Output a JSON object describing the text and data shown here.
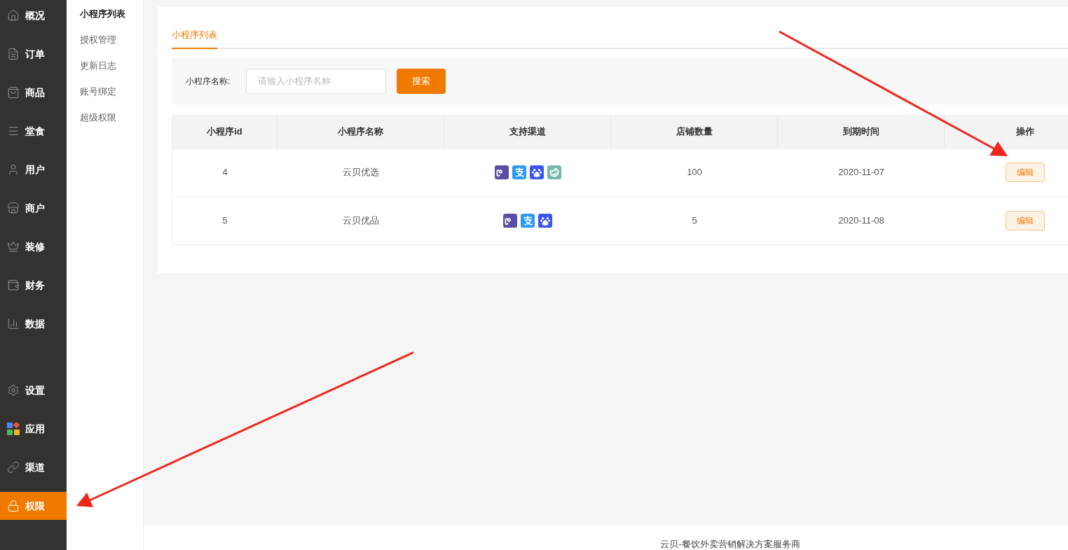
{
  "sidebar": {
    "top_items": [
      {
        "kind": "home",
        "label": "概况",
        "selected": false
      },
      {
        "kind": "order",
        "label": "订单",
        "selected": false
      },
      {
        "kind": "bag",
        "label": "商品",
        "selected": false
      },
      {
        "kind": "lines",
        "label": "堂食",
        "selected": false
      },
      {
        "kind": "user",
        "label": "用户",
        "selected": false
      },
      {
        "kind": "store",
        "label": "商户",
        "selected": false
      },
      {
        "kind": "crown",
        "label": "装修",
        "selected": false
      },
      {
        "kind": "wallet",
        "label": "财务",
        "selected": false
      },
      {
        "kind": "chart",
        "label": "数据",
        "selected": false
      }
    ],
    "bottom_items": [
      {
        "kind": "gear",
        "label": "设置",
        "selected": false
      },
      {
        "kind": "apps",
        "label": "应用",
        "selected": false
      },
      {
        "kind": "link",
        "label": "渠道",
        "selected": false
      },
      {
        "kind": "lock",
        "label": "权限",
        "selected": true
      }
    ]
  },
  "submenu": [
    {
      "label": "小程序列表",
      "selected": true
    },
    {
      "label": "授权管理",
      "selected": false
    },
    {
      "label": "更新日志",
      "selected": false
    },
    {
      "label": "账号绑定",
      "selected": false
    },
    {
      "label": "超级权限",
      "selected": false
    }
  ],
  "tabs": [
    {
      "label": "小程序列表",
      "selected": true
    }
  ],
  "search": {
    "label": "小程序名称:",
    "placeholder": "请输入小程序名称",
    "button": "搜索"
  },
  "table": {
    "columns": [
      "小程序id",
      "小程序名称",
      "支持渠道",
      "店铺数量",
      "到期时间",
      "操作"
    ],
    "rows": [
      {
        "id": "4",
        "name": "云贝优选",
        "channels": [
          {
            "kind": "miniapp"
          },
          {
            "kind": "alipay"
          },
          {
            "kind": "baidu"
          },
          {
            "kind": "other"
          }
        ],
        "stores": "100",
        "expiry": "2020-11-07",
        "action": "编辑"
      },
      {
        "id": "5",
        "name": "云贝优品",
        "channels": [
          {
            "kind": "miniapp"
          },
          {
            "kind": "alipay"
          },
          {
            "kind": "baidu"
          }
        ],
        "stores": "5",
        "expiry": "2020-11-08",
        "action": "编辑"
      }
    ]
  },
  "footer": "云贝-餐饮外卖营销解决方案服务商"
}
